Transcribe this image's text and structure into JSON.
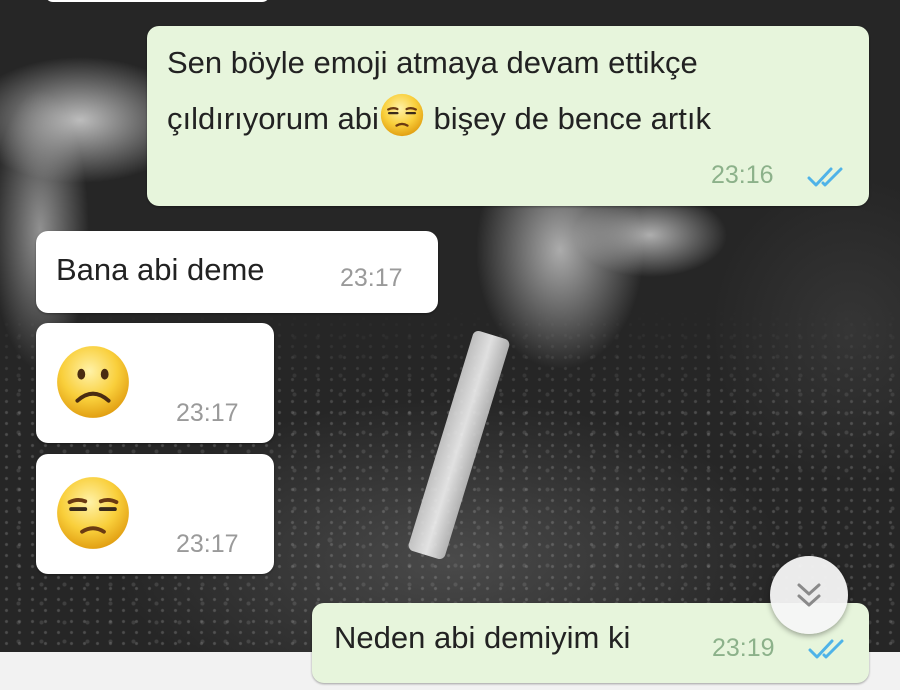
{
  "messages": [
    {
      "direction": "outgoing",
      "line1": "Sen böyle emoji atmaya devam ettikçe",
      "line2_before_emoji": "çıldırıyorum abi",
      "inline_emoji": "unamused-face",
      "line2_after_emoji": " bişey de bence artık",
      "time": "23:16",
      "status": "read"
    },
    {
      "direction": "incoming",
      "text": "Bana abi deme",
      "time": "23:17"
    },
    {
      "direction": "incoming",
      "emoji": "slightly-frowning-face",
      "time": "23:17"
    },
    {
      "direction": "incoming",
      "emoji": "unamused-face",
      "time": "23:17"
    },
    {
      "direction": "outgoing",
      "text": "Neden abi demiyim ki",
      "time": "23:19",
      "status": "read"
    }
  ],
  "scroll_button_icon": "double-chevron-down-icon",
  "colors": {
    "outgoing_bubble": "#e7f5dc",
    "incoming_bubble": "#ffffff",
    "read_ticks": "#4fb3e8",
    "outgoing_time": "#8cb18a",
    "incoming_time": "#9a9a9a"
  }
}
